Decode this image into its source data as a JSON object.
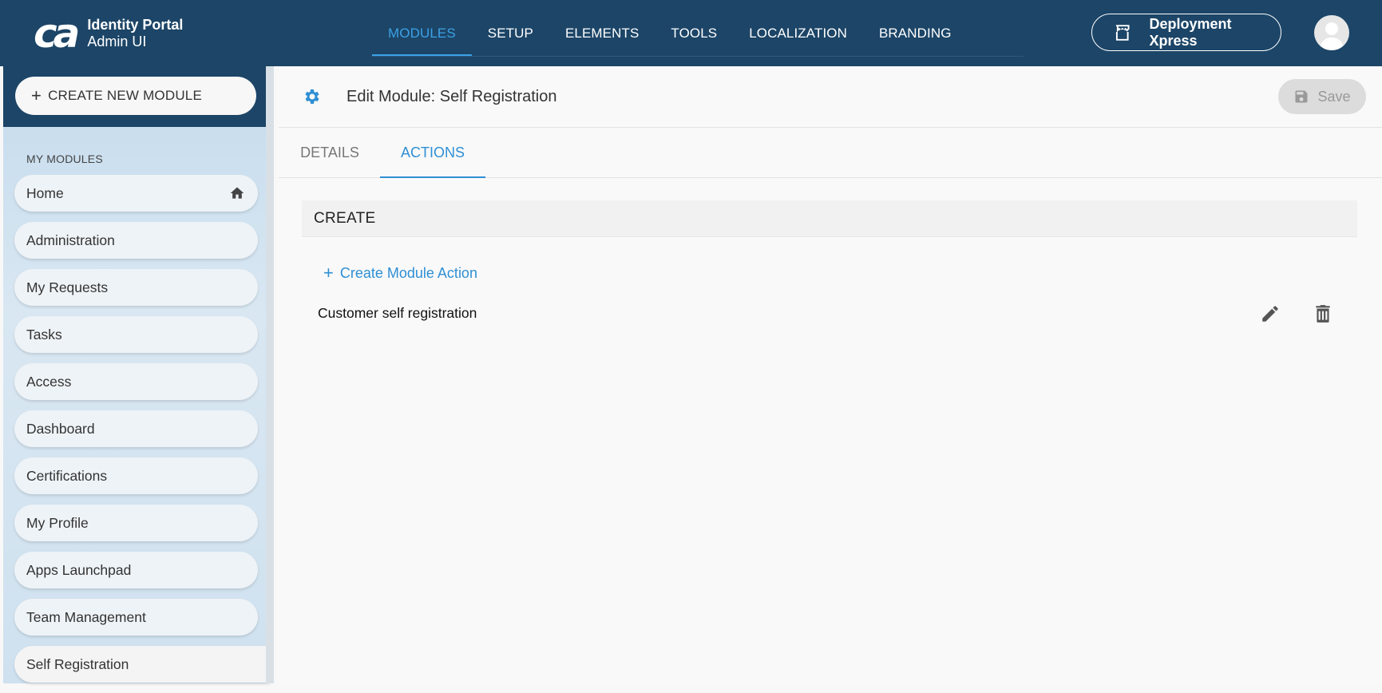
{
  "header": {
    "logo_mark": "ca",
    "logo_title": "Identity Portal",
    "logo_subtitle": "Admin UI",
    "nav": [
      "MODULES",
      "SETUP",
      "ELEMENTS",
      "TOOLS",
      "LOCALIZATION",
      "BRANDING"
    ],
    "active_nav": "MODULES",
    "deploy_label": "Deployment Xpress",
    "accent_color": "#3ca1e6",
    "background_color": "#1c4567"
  },
  "sidebar": {
    "create_label": "CREATE NEW MODULE",
    "heading": "MY MODULES",
    "items": [
      {
        "label": "Home",
        "icon": "home-icon"
      },
      {
        "label": "Administration"
      },
      {
        "label": "My Requests"
      },
      {
        "label": "Tasks"
      },
      {
        "label": "Access"
      },
      {
        "label": "Dashboard"
      },
      {
        "label": "Certifications"
      },
      {
        "label": "My Profile"
      },
      {
        "label": "Apps Launchpad"
      },
      {
        "label": "Team Management"
      },
      {
        "label": "Self Registration"
      }
    ],
    "active_item": "Self Registration"
  },
  "main": {
    "title": "Edit Module: Self Registration",
    "title_icon": "gear-icon",
    "save_label": "Save",
    "tabs": [
      {
        "label": "DETAILS"
      },
      {
        "label": "ACTIONS"
      }
    ],
    "active_tab": "ACTIONS",
    "section": {
      "title": "CREATE",
      "create_label": "Create Module Action",
      "actions": [
        {
          "name": "Customer self registration"
        }
      ]
    }
  }
}
